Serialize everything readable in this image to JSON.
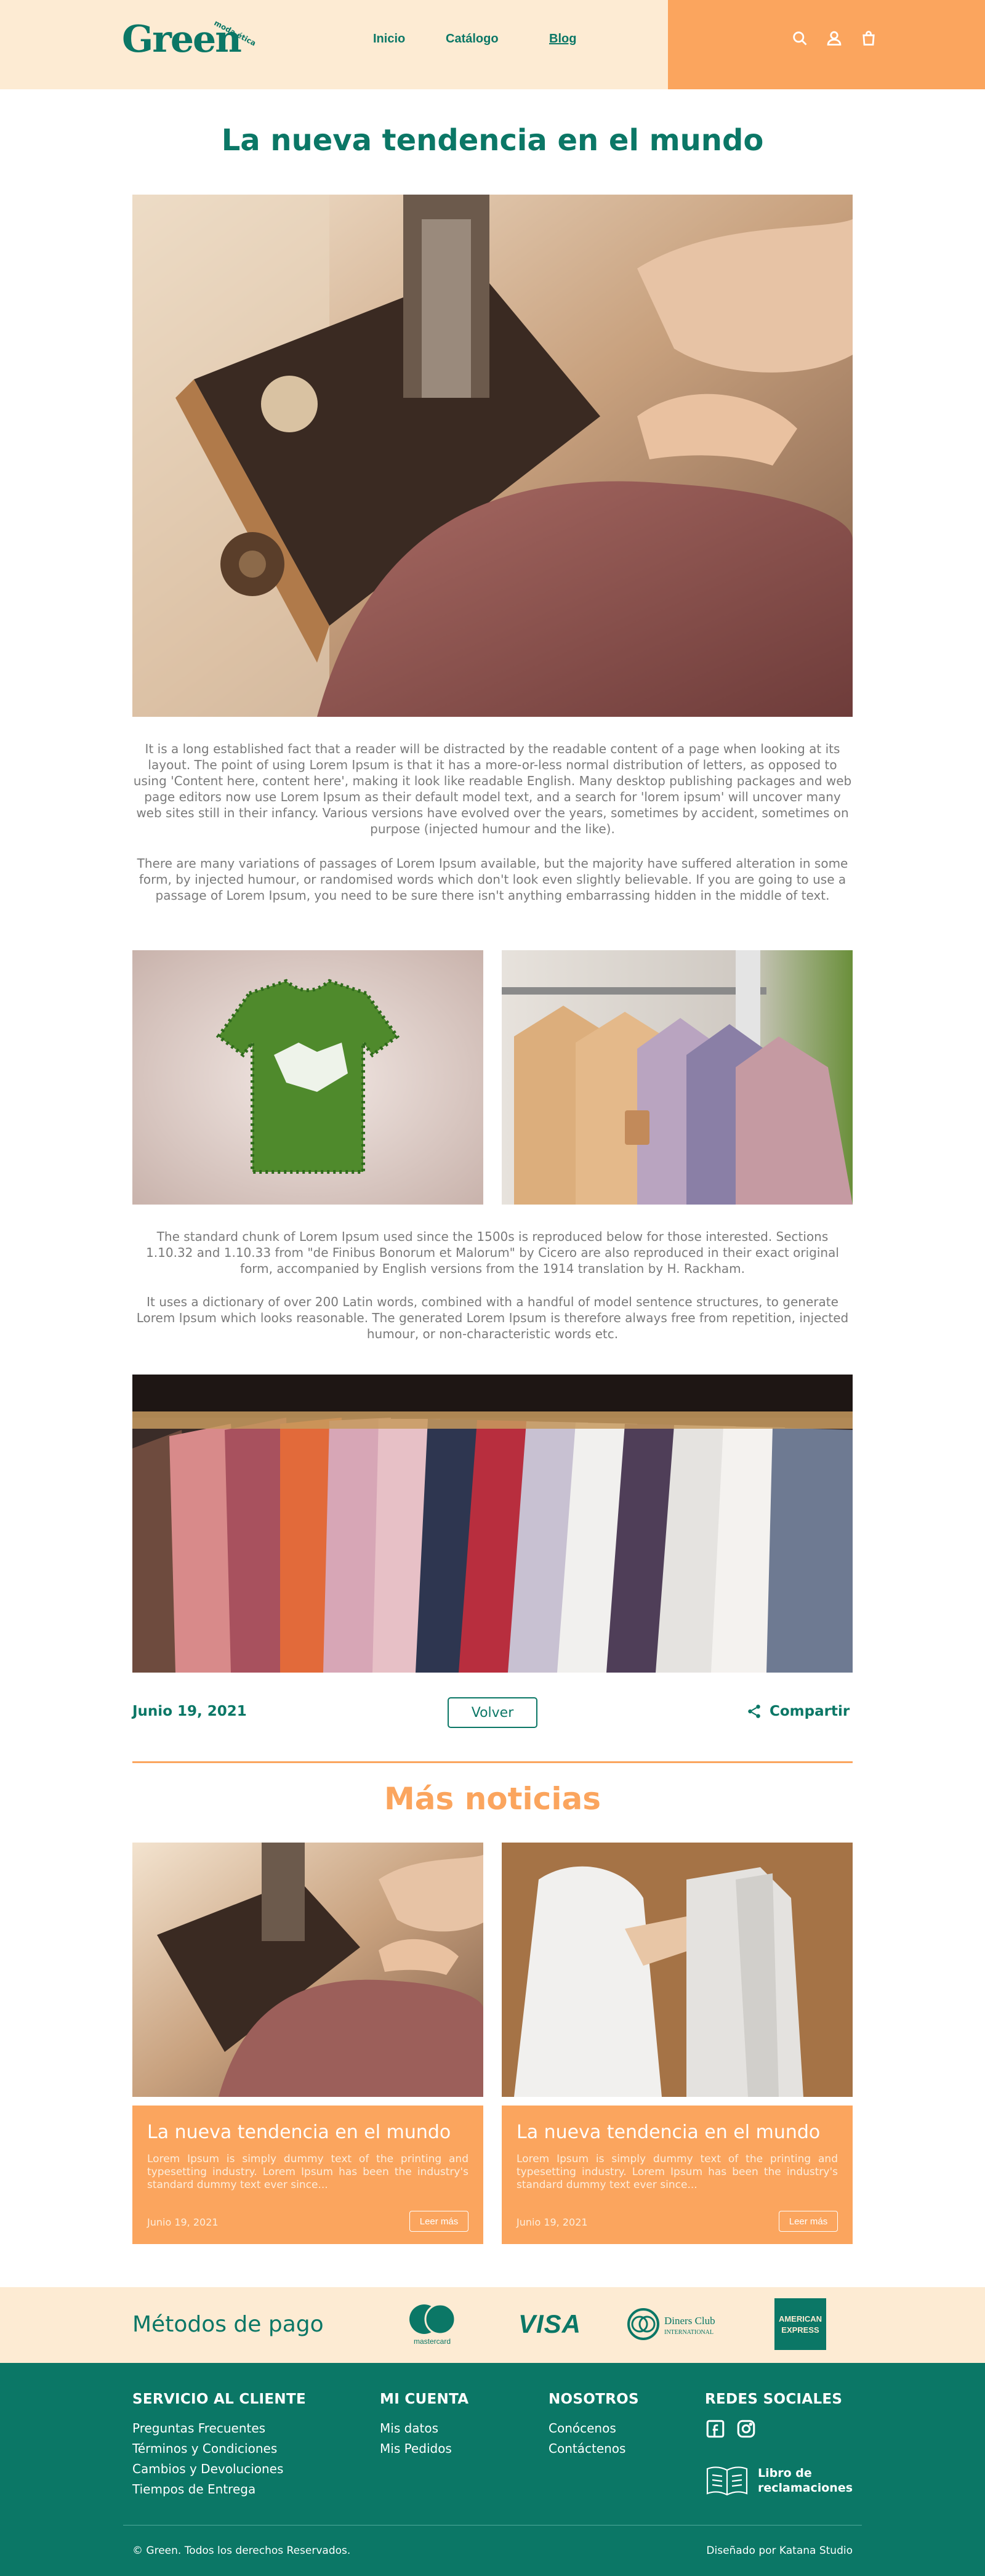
{
  "header": {
    "logo": "Green",
    "logo_tag": "moda ética",
    "nav": [
      "Inicio",
      "Catálogo",
      "Blog"
    ]
  },
  "article": {
    "title": "La nueva tendencia en el mundo",
    "paragraphs": [
      "It is a long established fact that a reader will be distracted by the readable content of a page when looking at its layout. The point of using Lorem Ipsum is that it has a more-or-less normal distribution of letters, as opposed to using 'Content here, content here', making it look like readable English. Many desktop publishing packages and web page editors now use Lorem Ipsum as their default model text, and a search for 'lorem ipsum' will uncover many web sites still in their infancy. Various versions have evolved over the years, sometimes by accident, sometimes on purpose (injected humour and the like).",
      "There are many variations of passages of Lorem Ipsum available, but the majority have suffered alteration in some form, by injected humour, or randomised words which don't look even slightly believable. If you are going to use a passage of Lorem Ipsum, you need to be sure there isn't anything embarrassing hidden in the middle of text.",
      "The standard chunk of Lorem Ipsum used since the 1500s is reproduced below for those interested. Sections 1.10.32 and 1.10.33 from \"de Finibus Bonorum et Malorum\" by Cicero are also reproduced in their exact original form, accompanied by English versions from the 1914 translation by H. Rackham.",
      "It uses a dictionary of over 200 Latin words, combined with a handful of model sentence structures, to generate Lorem Ipsum which looks reasonable. The generated Lorem Ipsum is therefore always free from repetition, injected humour, or non-characteristic words etc."
    ],
    "date": "Junio 19, 2021",
    "back_label": "Volver",
    "share_label": "Compartir"
  },
  "more_news": {
    "title": "Más noticias",
    "cards": [
      {
        "title": "La nueva tendencia en el mundo",
        "text": "Lorem Ipsum is simply dummy text of the printing and typesetting industry. Lorem Ipsum has been the industry's standard dummy text ever since...",
        "date": "Junio 19, 2021",
        "button": "Leer más"
      },
      {
        "title": "La nueva tendencia en el mundo",
        "text": "Lorem Ipsum is simply dummy text of the printing and typesetting industry. Lorem Ipsum has been the industry's standard dummy text ever since...",
        "date": "Junio 19, 2021",
        "button": "Leer más"
      }
    ]
  },
  "payment": {
    "label": "Métodos de pago",
    "mastercard": "mastercard",
    "visa": "VISA",
    "diners_1": "Diners Club",
    "diners_2": "INTERNATIONAL",
    "amex_1": "AMERICAN",
    "amex_2": "EXPRESS"
  },
  "footer": {
    "service": {
      "title": "SERVICIO AL CLIENTE",
      "links": [
        "Preguntas Frecuentes",
        "Términos y Condiciones",
        "Cambios y Devoluciones",
        "Tiempos de Entrega"
      ]
    },
    "account": {
      "title": "MI CUENTA",
      "links": [
        "Mis datos",
        "Mis Pedidos"
      ]
    },
    "about": {
      "title": "NOSOTROS",
      "links": [
        "Conócenos",
        "Contáctenos"
      ]
    },
    "social": {
      "title": "REDES SOCIALES",
      "libro": "Libro de reclamaciones"
    },
    "copyright": "© Green. Todos los derechos Reservados.",
    "designed_by": "Diseñado por Katana Studio"
  },
  "colors": {
    "brand_green": "#0b7766",
    "accent_orange": "#fba55e",
    "cream": "#fdebd3"
  }
}
